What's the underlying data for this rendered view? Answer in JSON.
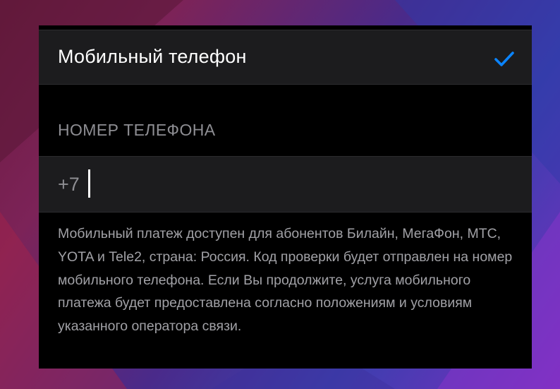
{
  "colors": {
    "accent": "#0a84ff",
    "panel_background": "#000000",
    "row_background": "#1c1c1e",
    "secondary_text": "#8e8e93"
  },
  "payment_option": {
    "label": "Мобильный телефон",
    "selected": true,
    "icon": "checkmark-icon"
  },
  "phone_section": {
    "header": "НОМЕР ТЕЛЕФОНА",
    "country_code": "+7",
    "value": ""
  },
  "footer": {
    "text": "Мобильный платеж доступен для абонентов Билайн, МегаФон, МТС, YOTA и Tele2, страна: Россия. Код проверки будет отправлен на номер мобильного телефона. Если Вы продолжите, услуга мобильного платежа будет предоставлена согласно положениям и условиям указанного оператора связи."
  }
}
